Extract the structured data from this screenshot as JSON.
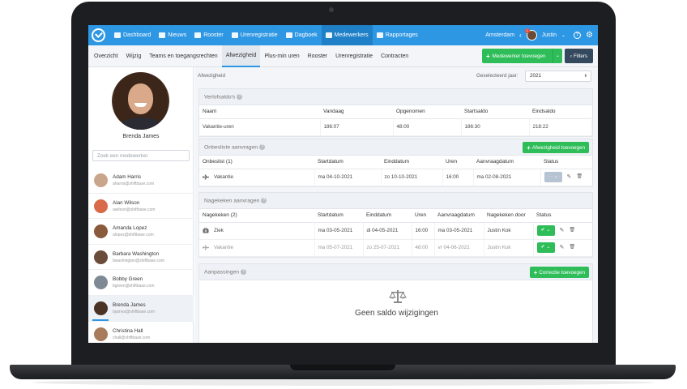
{
  "topbar": {
    "nav": [
      {
        "label": "Dashboard",
        "icon": "dashboard-icon"
      },
      {
        "label": "Nieuws",
        "icon": "chat-icon"
      },
      {
        "label": "Rooster",
        "icon": "calendar-icon"
      },
      {
        "label": "Urenregistratie",
        "icon": "clock-icon"
      },
      {
        "label": "Dagboek",
        "icon": "book-icon"
      },
      {
        "label": "Medewerkers",
        "icon": "users-icon",
        "active": true
      },
      {
        "label": "Rapportages",
        "icon": "bar-chart-icon"
      }
    ],
    "location": "Amsterdam",
    "user": "Justin",
    "notification_count": "1",
    "help_glyph": "?",
    "brand_color": "#2e97e4"
  },
  "subnav": {
    "items": [
      "Overzicht",
      "Wijzig",
      "Teams en toegangsrechten",
      "Afwezigheid",
      "Plus-min uren",
      "Rooster",
      "Urenregistratie",
      "Contracten"
    ],
    "active": "Afwezigheid",
    "add_employee": "Medewerker toevoegen",
    "filters": "Filters"
  },
  "sidebar": {
    "profile_name": "Brenda James",
    "search_placeholder": "Zoek een medewerker",
    "employees": [
      {
        "name": "Adam Harris",
        "email": "aharris@shiftbase.com",
        "color": "#c9a58b"
      },
      {
        "name": "Alan Wilson",
        "email": "awilson@shiftbase.com",
        "color": "#d86a4a"
      },
      {
        "name": "Amanda Lopez",
        "email": "alopez@shiftbase.com",
        "color": "#8a5a3c"
      },
      {
        "name": "Barbara Washington",
        "email": "bwashington@shiftbase.com",
        "color": "#6b4c3b"
      },
      {
        "name": "Bobby Green",
        "email": "bgreen@shiftbase.com",
        "color": "#7d8a95"
      },
      {
        "name": "Brenda James",
        "email": "bjames@shiftbase.com",
        "color": "#4a3325",
        "selected": true
      },
      {
        "name": "Christina Hall",
        "email": "chall@shiftbase.com",
        "color": "#a87b5b"
      }
    ]
  },
  "main": {
    "title": "Afwezigheid",
    "year_label": "Geselecteerd jaar:",
    "year": "2021",
    "leave_balances": {
      "title": "Verlofsaldo's",
      "columns": [
        "Naam",
        "Vandaag",
        "Opgenomen",
        "Startsaldo",
        "Eindsaldo"
      ],
      "rows": [
        [
          "Vakantie-uren",
          "186:07",
          "48:00",
          "186:30",
          "218:22"
        ]
      ]
    },
    "pending": {
      "title": "Onbesliste aanvragen",
      "add_button": "Afwezigheid toevoegen",
      "columns": [
        "Onbeslist (1)",
        "Startdatum",
        "Einddatum",
        "Uren",
        "Aanvraagdatum",
        "Status"
      ],
      "rows": [
        {
          "type": "Vakantie",
          "icon": "plane-icon",
          "start": "ma 04-10-2021",
          "end": "zo 10-10-2021",
          "hours": "16:00",
          "requested": "ma 02-08-2021",
          "status": "···"
        }
      ]
    },
    "reviewed": {
      "title": "Nagekeken aanvragen",
      "columns": [
        "Nagekeken (2)",
        "Startdatum",
        "Einddatum",
        "Uren",
        "Aanvraagdatum",
        "Nagekeken door",
        "Status"
      ],
      "rows": [
        {
          "type": "Ziek",
          "icon": "medkit-icon",
          "start": "ma 03-05-2021",
          "end": "di 04-05-2021",
          "hours": "16:00",
          "requested": "ma 03-05-2021",
          "by": "Justin Kok",
          "status": "✔",
          "muted": false
        },
        {
          "type": "Vakantie",
          "icon": "plane-icon",
          "start": "ma 05-07-2021",
          "end": "zo 25-07-2021",
          "hours": "48:00",
          "requested": "vr 04-06-2021",
          "by": "Justin Kok",
          "status": "✔",
          "muted": true
        }
      ]
    },
    "adjustments": {
      "title": "Aanpassingen",
      "add_button": "Correctie toevoegen",
      "empty_text": "Geen saldo wijzigingen"
    }
  }
}
